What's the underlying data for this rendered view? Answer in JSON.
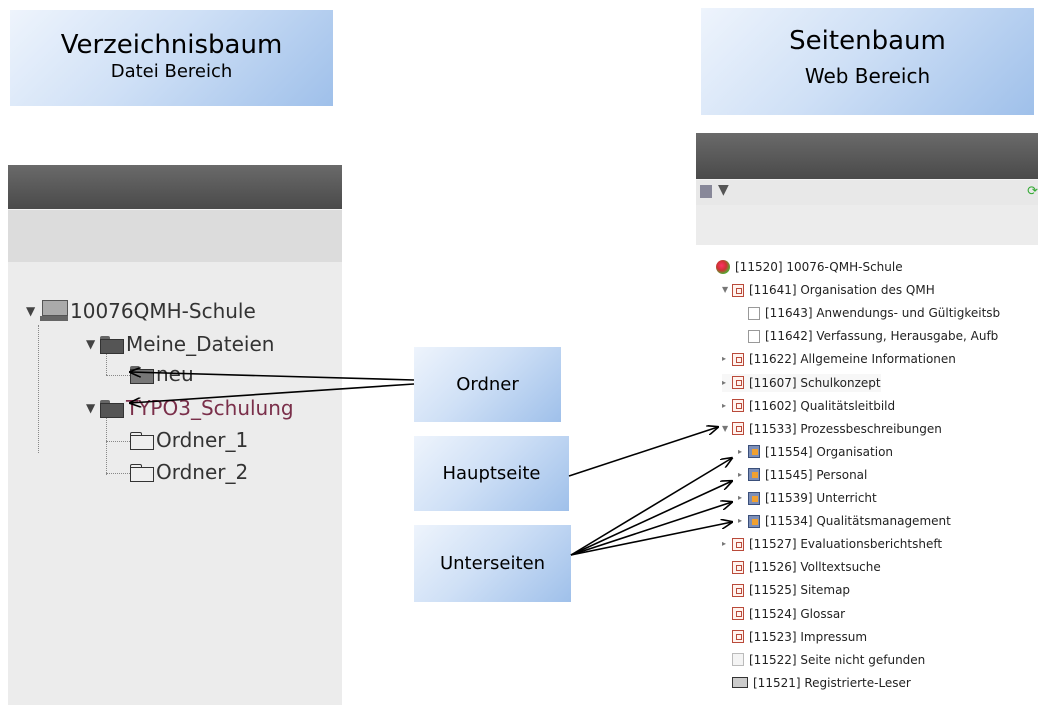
{
  "left_title": {
    "line1": "Verzeichnisbaum",
    "line2": "Datei Bereich"
  },
  "right_title": {
    "line1": "Seitenbaum",
    "line2": "Web Bereich"
  },
  "labels": {
    "ordner": "Ordner",
    "hauptseite": "Hauptseite",
    "unterseiten": "Unterseiten"
  },
  "left_tree": {
    "root": "10076QMH-Schule",
    "meine_dateien": "Meine_Dateien",
    "neu": "neu",
    "typo3": "TYPO3_Schulung",
    "ordner1": "Ordner_1",
    "ordner2": "Ordner_2"
  },
  "right_tree": [
    "[11520] 10076-QMH-Schule",
    "[11641] Organisation des QMH",
    "[11643] Anwendungs- und Gültigkeitsb",
    "[11642] Verfassung, Herausgabe, Aufb",
    "[11622] Allgemeine Informationen",
    "[11607] Schulkonzept",
    "[11602] Qualitätsleitbild",
    "[11533] Prozessbeschreibungen",
    "[11554] Organisation",
    "[11545] Personal",
    "[11539] Unterricht",
    "[11534] Qualitätsmanagement",
    "[11527] Evaluationsberichtsheft",
    "[11526] Volltextsuche",
    "[11525] Sitemap",
    "[11524] Glossar",
    "[11523] Impressum",
    "[11522] Seite nicht gefunden",
    "[11521] Registrierte-Leser"
  ],
  "icons": [
    "server-icon",
    "folder-icon",
    "page-icon",
    "globe-icon",
    "filter-icon",
    "refresh-icon",
    "new-page-icon",
    "expand-arrow-icon"
  ]
}
